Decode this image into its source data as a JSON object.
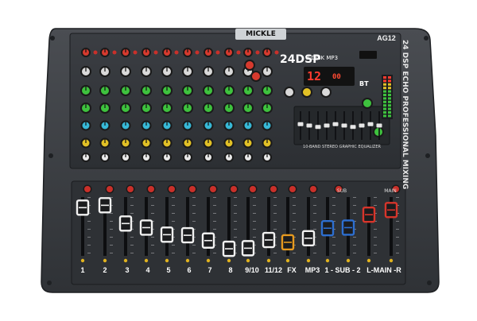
{
  "device": {
    "brand": "MICKLE",
    "model": "AG12",
    "dsp_badge": "24DSP",
    "player_label": "U-DISK MP3",
    "display_track": "12",
    "display_mode": "00",
    "bluetooth_label": "BT",
    "side_text": "24 DSP ECHO PROFESSIONAL MIXING",
    "eq_label": "10-BAND STEREO GRAPHIC EQUALIZER"
  },
  "channels": [
    "1",
    "2",
    "3",
    "4",
    "5",
    "6",
    "7",
    "8",
    "9/10",
    "11/12",
    "FX",
    "MP3",
    "1 - SUB - 2",
    "L-MAIN -R"
  ],
  "top_labels": {
    "sub": "SUB",
    "main": "MAIN"
  },
  "colors": {
    "body": "#3a3d41",
    "panel": "#2f3236",
    "fader_white": "#f2f2f2",
    "fader_orange": "#e79a1f",
    "fader_blue": "#2d6fd1",
    "fader_red": "#d7352b",
    "knob_green": "#3ec23e",
    "knob_cyan": "#37b8d6",
    "knob_yellow": "#e2c126",
    "led_red": "#ff3b2f"
  },
  "faders": [
    {
      "channel": "1",
      "level": 0.82,
      "cap": "white"
    },
    {
      "channel": "2",
      "level": 0.86,
      "cap": "white"
    },
    {
      "channel": "3",
      "level": 0.55,
      "cap": "white"
    },
    {
      "channel": "4",
      "level": 0.48,
      "cap": "white"
    },
    {
      "channel": "5",
      "level": 0.36,
      "cap": "white"
    },
    {
      "channel": "6",
      "level": 0.35,
      "cap": "white"
    },
    {
      "channel": "7",
      "level": 0.26,
      "cap": "white"
    },
    {
      "channel": "8",
      "level": 0.12,
      "cap": "white"
    },
    {
      "channel": "9/10",
      "level": 0.13,
      "cap": "white"
    },
    {
      "channel": "11/12",
      "level": 0.27,
      "cap": "white"
    },
    {
      "channel": "FX",
      "level": 0.23,
      "cap": "orange"
    },
    {
      "channel": "MP3",
      "level": 0.3,
      "cap": "white"
    },
    {
      "channel": "SUB 1",
      "level": 0.47,
      "cap": "blue"
    },
    {
      "channel": "SUB 2",
      "level": 0.48,
      "cap": "blue"
    },
    {
      "channel": "MAIN L",
      "level": 0.7,
      "cap": "red"
    },
    {
      "channel": "MAIN R",
      "level": 0.78,
      "cap": "red"
    }
  ],
  "eq_levels": [
    0.55,
    0.5,
    0.45,
    0.5,
    0.55,
    0.5,
    0.45,
    0.5,
    0.55,
    0.5
  ]
}
